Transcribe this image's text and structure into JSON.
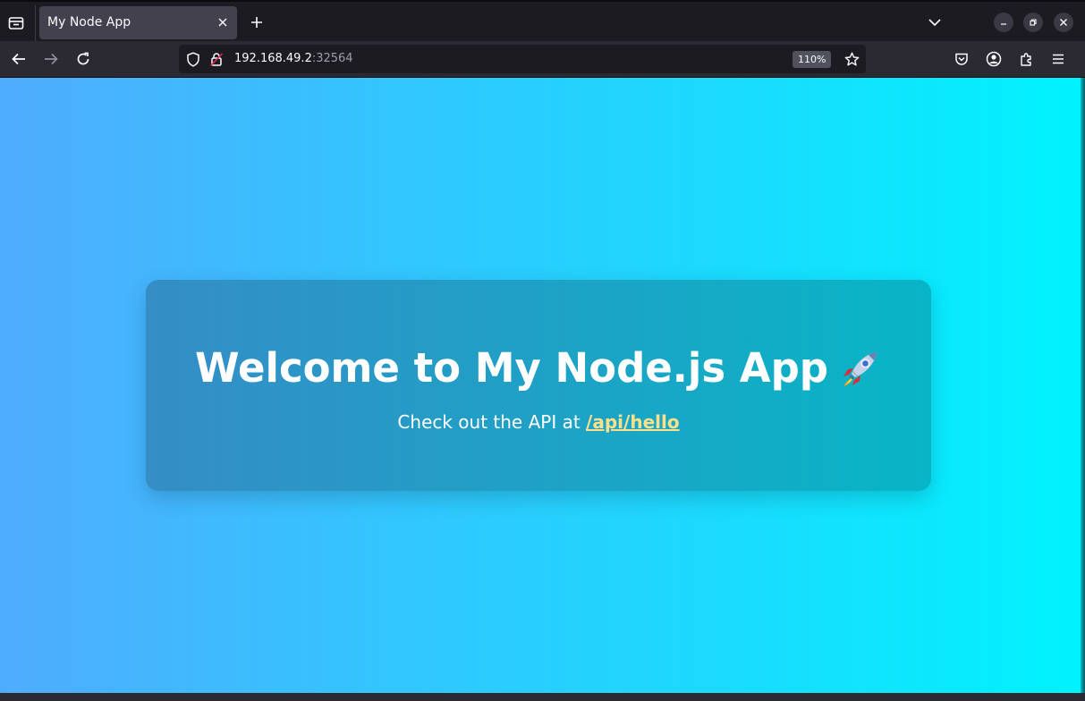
{
  "browser": {
    "tab": {
      "title": "My Node App"
    },
    "address": {
      "host": "192.168.49.2",
      "port": ":32564"
    },
    "zoom": "110%"
  },
  "page": {
    "heading": "Welcome to My Node.js App",
    "heading_emoji": "rocket-icon",
    "subtext_prefix": "Check out the API at ",
    "link_text": "/api/hello"
  },
  "colors": {
    "gradient_start": "#4facfe",
    "gradient_end": "#00f2fe",
    "link": "#ffe08a"
  }
}
